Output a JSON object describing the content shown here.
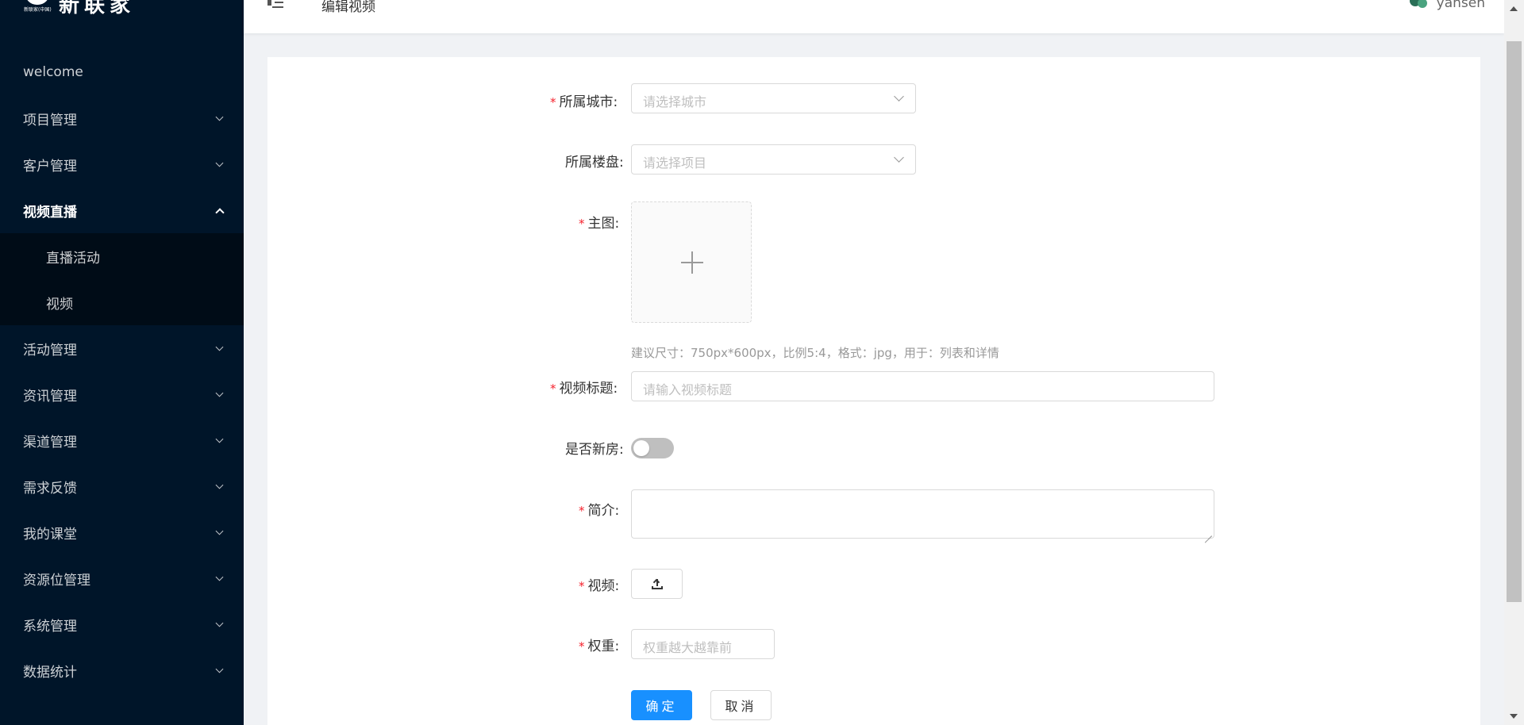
{
  "brand": {
    "logo_text": "新联家",
    "logo_subtext": "新联家(中国)"
  },
  "sidebar": {
    "items": [
      {
        "label": "welcome"
      },
      {
        "label": "项目管理"
      },
      {
        "label": "客户管理"
      },
      {
        "label": "视频直播",
        "open": true,
        "children": [
          {
            "label": "直播活动"
          },
          {
            "label": "视频"
          }
        ]
      },
      {
        "label": "活动管理"
      },
      {
        "label": "资讯管理"
      },
      {
        "label": "渠道管理"
      },
      {
        "label": "需求反馈"
      },
      {
        "label": "我的课堂"
      },
      {
        "label": "资源位管理"
      },
      {
        "label": "系统管理"
      },
      {
        "label": "数据统计"
      }
    ]
  },
  "header": {
    "title": "编辑视频",
    "username": "yansen"
  },
  "form": {
    "city": {
      "label": "所属城市:",
      "placeholder": "请选择城市",
      "required": true
    },
    "project": {
      "label": "所属楼盘:",
      "placeholder": "请选择项目",
      "required": false
    },
    "main_image": {
      "label": "主图:",
      "required": true,
      "hint": "建议尺寸：750px*600px，比例5:4，格式：jpg，用于：列表和详情"
    },
    "video_title": {
      "label": "视频标题:",
      "placeholder": "请输入视频标题",
      "required": true
    },
    "is_new_house": {
      "label": "是否新房:",
      "checked": false
    },
    "intro": {
      "label": "简介:",
      "required": true,
      "value": ""
    },
    "video": {
      "label": "视频:",
      "required": true
    },
    "weight": {
      "label": "权重:",
      "placeholder": "权重越大越靠前",
      "required": true
    },
    "confirm_label": "确定",
    "cancel_label": "取消"
  },
  "colors": {
    "sidebar_bg": "#001529",
    "submenu_bg": "#000c17",
    "primary": "#1890ff",
    "required": "#f5222d"
  }
}
